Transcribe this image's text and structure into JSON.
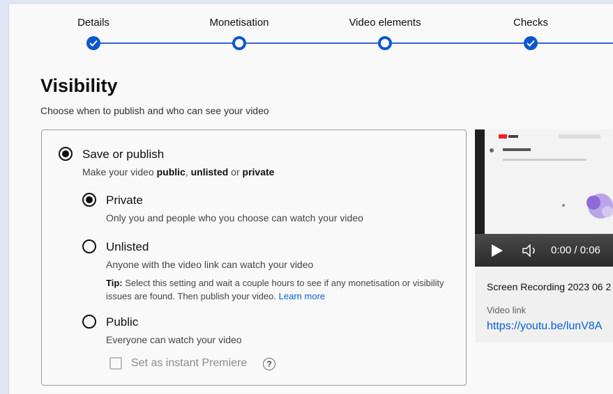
{
  "stepper": {
    "steps": [
      {
        "label": "Details",
        "state": "complete"
      },
      {
        "label": "Monetisation",
        "state": "current"
      },
      {
        "label": "Video elements",
        "state": "current"
      },
      {
        "label": "Checks",
        "state": "complete"
      }
    ],
    "accent": "#0b57d0"
  },
  "visibility": {
    "title": "Visibility",
    "subtitle": "Choose when to publish and who can see your video",
    "save_or_publish": {
      "label": "Save or publish",
      "desc_prefix": "Make your video ",
      "public": "public",
      "comma": ", ",
      "unlisted": "unlisted",
      "or": " or ",
      "private": "private",
      "selected": true
    },
    "options": {
      "private": {
        "label": "Private",
        "desc": "Only you and people who you choose can watch your video",
        "selected": true
      },
      "unlisted": {
        "label": "Unlisted",
        "desc": "Anyone with the video link can watch your video",
        "selected": false
      },
      "public": {
        "label": "Public",
        "desc": "Everyone can watch your video",
        "selected": false
      }
    },
    "tip": {
      "prefix": "Tip:",
      "text": " Select this setting and wait a couple hours to see if any monetisation or visibility issues are found. Then publish your video.",
      "link": "Learn more"
    },
    "premiere": {
      "label": "Set as instant Premiere",
      "help": "?",
      "checked": false
    }
  },
  "video": {
    "time": "0:00 / 0:06",
    "title": "Screen Recording 2023 06 2",
    "link_label": "Video link",
    "link": "https://youtu.be/lunV8A"
  }
}
